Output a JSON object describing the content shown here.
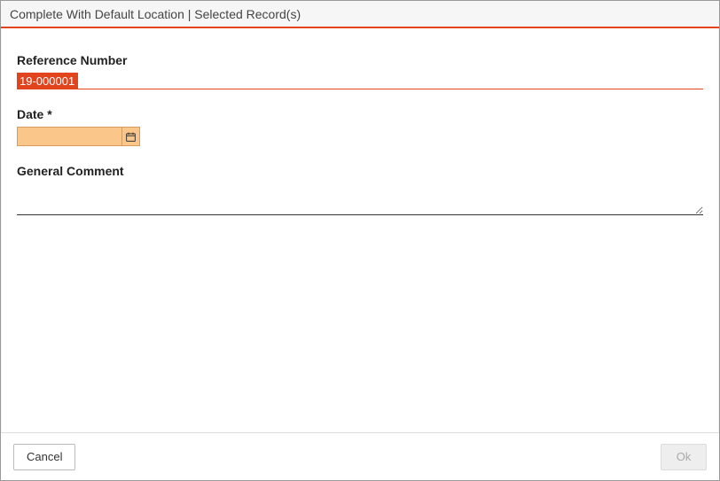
{
  "dialog": {
    "title": "Complete With Default Location | Selected Record(s)"
  },
  "fields": {
    "reference": {
      "label": "Reference Number",
      "value": "19-000001"
    },
    "date": {
      "label": "Date *",
      "value": ""
    },
    "comment": {
      "label": "General Comment",
      "value": ""
    }
  },
  "footer": {
    "cancel_label": "Cancel",
    "ok_label": "Ok"
  }
}
